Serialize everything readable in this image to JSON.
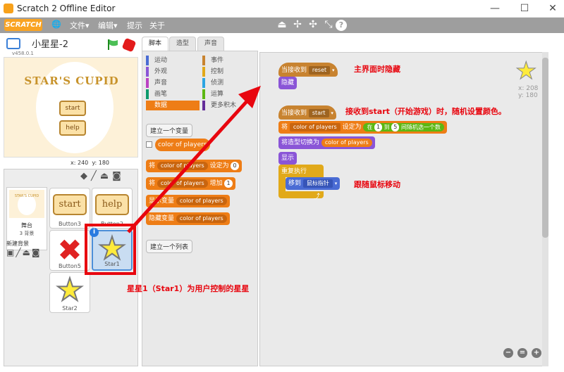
{
  "window": {
    "title": "Scratch 2 Offline Editor",
    "minimize": "—",
    "maximize": "☐",
    "close": "✕"
  },
  "menubar": {
    "logo": "SCRATCH",
    "globe": "🌐",
    "file": "文件▾",
    "edit": "编辑▾",
    "tips": "提示",
    "about": "关于"
  },
  "toolbar": {
    "stamp": "⏏",
    "grow": "✢",
    "expand": "✣",
    "shrink": "⤡",
    "help": "?"
  },
  "project": {
    "name": "小星星-2",
    "version": "v458.0.1"
  },
  "stage": {
    "title": "STAR'S CUPID",
    "start": "start",
    "help": "help",
    "coord_x": "x: 240",
    "coord_y": "y: 180"
  },
  "sprites": {
    "stage_label": "舞台",
    "stage_backdrops": "3 背景",
    "new_backdrop": "新建背景",
    "items": [
      {
        "name": "Button3",
        "text": "start"
      },
      {
        "name": "Button2",
        "text": "help"
      },
      {
        "name": "Button5",
        "text": "✖"
      },
      {
        "name": "Star1",
        "text": "★"
      },
      {
        "name": "Star2",
        "text": "★"
      }
    ],
    "stage_thumb_text": "STAR'S CUPID"
  },
  "tabs": {
    "scripts": "脚本",
    "costumes": "造型",
    "sounds": "声音"
  },
  "categories": [
    {
      "label": "运动",
      "color": "#4a6cd4"
    },
    {
      "label": "事件",
      "color": "#c88330"
    },
    {
      "label": "外观",
      "color": "#8a55d7"
    },
    {
      "label": "控制",
      "color": "#e1a91a"
    },
    {
      "label": "声音",
      "color": "#bb42c3"
    },
    {
      "label": "侦测",
      "color": "#2ca5e2"
    },
    {
      "label": "画笔",
      "color": "#0e9a6c"
    },
    {
      "label": "运算",
      "color": "#5cb712"
    },
    {
      "label": "数据",
      "color": "#ee7d16"
    },
    {
      "label": "更多积木",
      "color": "#632d99"
    }
  ],
  "palette": {
    "make_variable": "建立一个变量",
    "variable_name": "color of players",
    "set_block": "将",
    "set_to": "设定为",
    "set_value": "0",
    "change_block": "将",
    "change_by": "增加",
    "change_value": "1",
    "show_var": "显示变量",
    "hide_var": "隐藏变量",
    "make_list": "建立一个列表"
  },
  "scripts": {
    "when_receive1": "当接收到",
    "msg1": "reset",
    "hide": "隐藏",
    "when_receive2": "当接收到",
    "msg2": "start",
    "set": "将",
    "var": "color of players",
    "set_to": "设定为",
    "pick": "在",
    "from": "1",
    "to_word": "到",
    "to": "5",
    "pick_tail": "间随机选一个数",
    "switch": "将造型切换为",
    "switch_var": "color of players",
    "show": "显示",
    "forever": "重复执行",
    "goto": "移到",
    "goto_target": "鼠标指针"
  },
  "sprite_info": {
    "x": "x: 208",
    "y": "y: 180"
  },
  "annotations": {
    "a1": "主界面时隐藏",
    "a2": "接收到start（开始游戏）时，随机设置颜色。",
    "a3": "跟随鼠标移动",
    "a4": "星星1（Star1）为用户控制的星星"
  },
  "zoom": {
    "out": "−",
    "reset": "=",
    "in": "+"
  }
}
